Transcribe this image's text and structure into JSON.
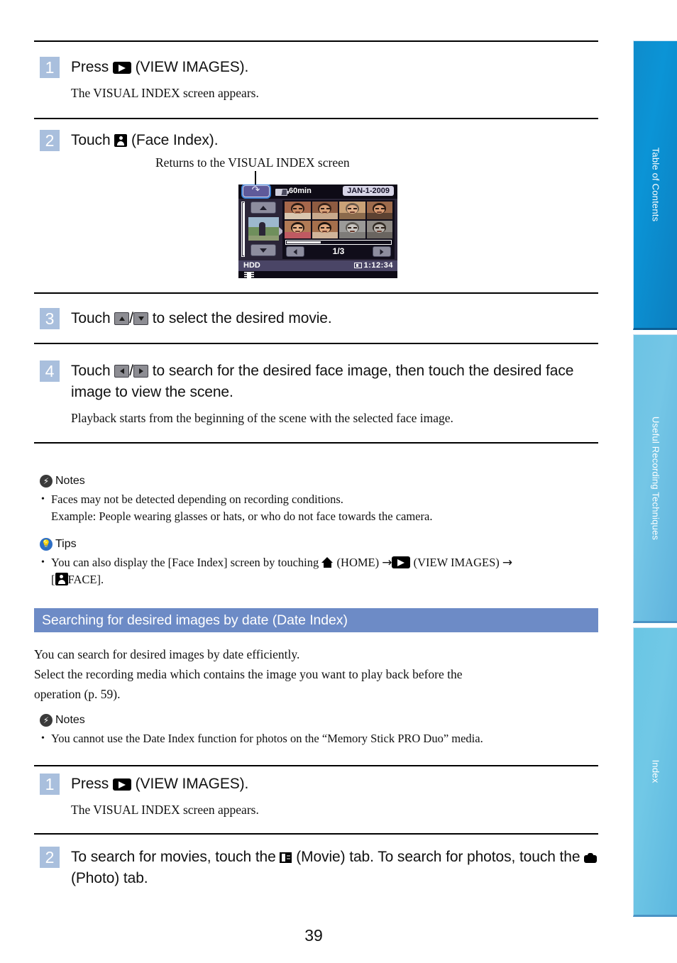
{
  "page": {
    "number": "39"
  },
  "side_tabs": [
    {
      "label": "Table of Contents",
      "active": true
    },
    {
      "label": "Useful Recording Techniques",
      "active": false
    },
    {
      "label": "Index",
      "active": false
    }
  ],
  "face_index_steps": [
    {
      "number": "1",
      "title_before": "Press ",
      "icon": "view-images-icon",
      "title_after": " (VIEW IMAGES).",
      "sub": "The VISUAL INDEX screen appears."
    },
    {
      "number": "2",
      "title_before": "Touch ",
      "icon": "face-index-icon",
      "title_after": " (Face Index)."
    },
    {
      "number": "3",
      "title_before": "Touch ",
      "icon_a": "up-arrow-icon",
      "separator": "/",
      "icon_b": "down-arrow-icon",
      "title_after": " to select the desired movie."
    },
    {
      "number": "4",
      "title_before": "Touch ",
      "icon_a": "left-arrow-icon",
      "separator": "/",
      "icon_b": "right-arrow-icon",
      "title_after": " to search for the desired face image, then touch the desired face image to view the scene.",
      "sub": "Playback starts from the beginning of the scene with the selected face image."
    }
  ],
  "callout": {
    "text": "Returns to the VISUAL INDEX screen"
  },
  "camera_screen": {
    "return_button": "return-arrow-icon",
    "battery_icon": "battery-icon",
    "battery_time": "60min",
    "date": "JAN-1-2009",
    "up_button": "up-arrow-icon",
    "down_button": "down-arrow-icon",
    "nav_left": "left-arrow-icon",
    "nav_right": "right-arrow-icon",
    "page_indicator": "1/3",
    "media_label": "HDD",
    "recordable_time": "1:12:34",
    "movie_tab_icon": "movie-tab-icon",
    "face_thumbnails": [
      {
        "skin": "#c98a63",
        "hair": "#2b1b14",
        "bg": "#a5674b",
        "shirt": "#d9c7b0"
      },
      {
        "skin": "#d8a178",
        "hair": "#3a241a",
        "bg": "#8e5b41",
        "shirt": "#c9a98c"
      },
      {
        "skin": "#e0b08a",
        "hair": "#6d5a4a",
        "bg": "#caa277",
        "shirt": "#8b6a4c"
      },
      {
        "skin": "#d89b73",
        "hair": "#2a1a12",
        "bg": "#9d6a4b",
        "shirt": "#5d4232"
      },
      {
        "skin": "#e5b288",
        "hair": "#241711",
        "bg": "#b07a55",
        "shirt": "#c05a62"
      },
      {
        "skin": "#e2ab82",
        "hair": "#1f140e",
        "bg": "#a56f4c",
        "shirt": "#d1b49a"
      },
      {
        "skin": "#c9c6c2",
        "hair": "#5a5650",
        "bg": "#9b9a98",
        "shirt": "#7e7c79"
      },
      {
        "skin": "#b9b3ad",
        "hair": "#332b24",
        "bg": "#8d8883",
        "shirt": "#6a6560"
      }
    ]
  },
  "notes_face": {
    "heading": "Notes",
    "icon": "notes-badge-icon",
    "items": [
      "Faces may not be detected depending on recording conditions.",
      "Example: People wearing glasses or hats, or who do not face towards the camera."
    ]
  },
  "tips_face": {
    "heading": "Tips",
    "icon": "tips-badge-icon",
    "text_1": "You can also display the [Face Index] screen by touching ",
    "home_icon": "home-icon",
    "text_2": " (HOME) ",
    "arrow_1": "→",
    "view_icon": "view-images-icon",
    "text_3": " (VIEW IMAGES) ",
    "arrow_2": "→",
    "text_4": "[",
    "face_icon": "face-index-icon",
    "text_5": "FACE]."
  },
  "date_index_section": {
    "header": "Searching for desired images by date (Date Index)",
    "body_lines": [
      "You can search for desired images by date efficiently.",
      "Select the recording media which contains the image you want to play back before the",
      "operation (p. 59)."
    ],
    "notes": {
      "heading": "Notes",
      "icon": "notes-badge-icon",
      "items": [
        "You cannot use the Date Index function for photos on the “Memory Stick PRO Duo” media."
      ]
    },
    "steps": [
      {
        "number": "1",
        "title_before": "Press ",
        "icon": "view-images-icon",
        "title_after": " (VIEW IMAGES).",
        "sub": "The VISUAL INDEX screen appears."
      },
      {
        "number": "2",
        "title_before": "To search for movies, touch the ",
        "movie_icon": "movie-tab-icon",
        "title_mid": " (Movie) tab. To search for photos, touch the ",
        "photo_icon": "photo-tab-icon",
        "title_after": " (Photo) tab."
      }
    ]
  }
}
